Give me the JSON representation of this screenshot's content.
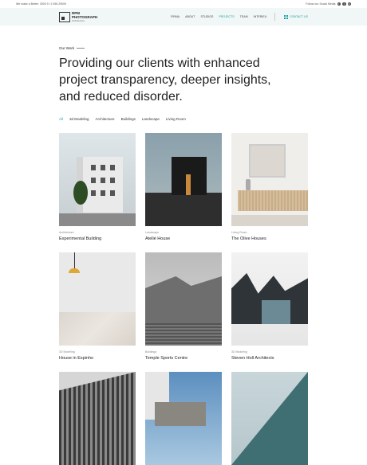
{
  "topbar": {
    "left": "We make a Better: 3000 9 / 2 456 29009",
    "right": "Follow our Social Media"
  },
  "social": [
    "f",
    "t",
    "in"
  ],
  "logo": {
    "line1": "RPM",
    "line2": "PHOTOGRAPH",
    "line3": "Architecture"
  },
  "menu": [
    "FIRMA",
    "ABOUT",
    "STUDIOS",
    "PROJECTS",
    "TEAM",
    "INTERIEU"
  ],
  "contact": "CONTACT US",
  "section_label": "Our Work",
  "headline": "Providing our clients with enhanced project transparency, deeper insights, and reduced disorder.",
  "filters": [
    "All",
    "3d Modeling",
    "Architecture",
    "Buildings",
    "Landscape",
    "Living Room"
  ],
  "projects": [
    {
      "cat": "Architecture",
      "title": "Experimental Building"
    },
    {
      "cat": "Landscape",
      "title": "Atelié House"
    },
    {
      "cat": "Living Room",
      "title": "The Olive Houses"
    },
    {
      "cat": "3D Modeling",
      "title": "House in Espinho"
    },
    {
      "cat": "Buildings",
      "title": "Temple Sports Centre"
    },
    {
      "cat": "3D Modeling",
      "title": "Steven Holl Architects"
    }
  ],
  "colors": {
    "accent": "#17a3a3",
    "nav_bg": "#f1f6f6"
  }
}
